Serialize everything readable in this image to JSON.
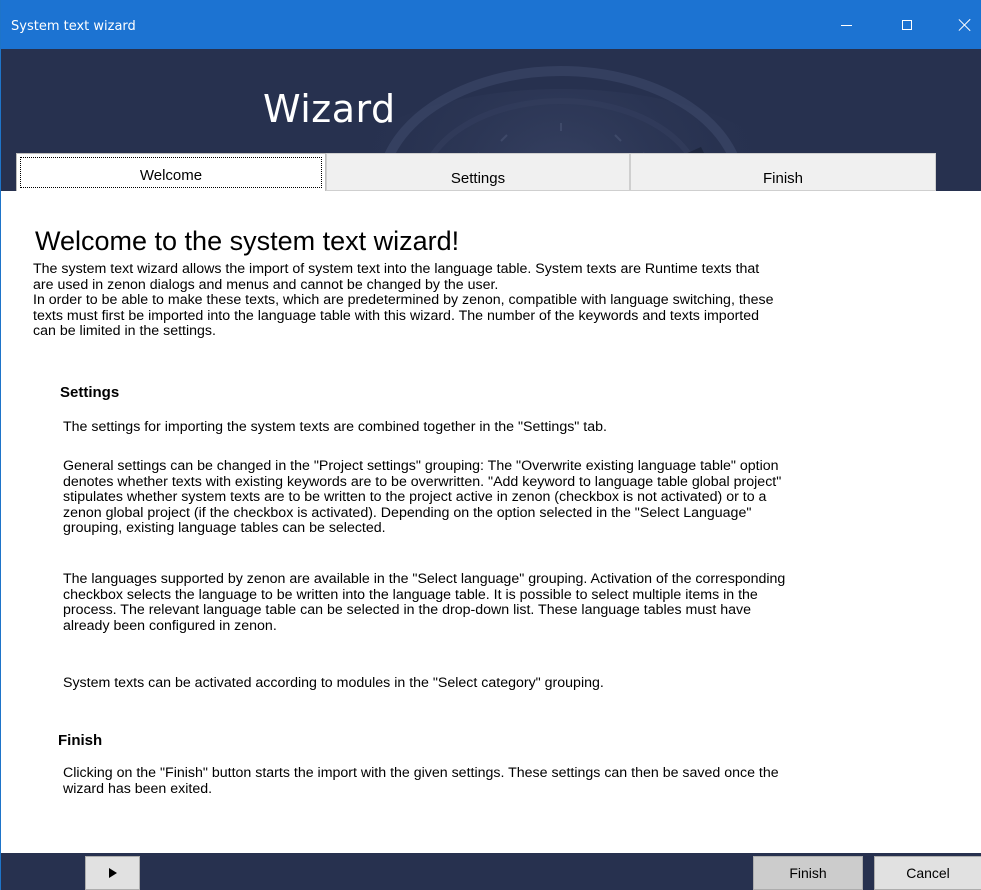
{
  "window": {
    "title": "System text wizard",
    "controls": {
      "minimize": "minimize-icon",
      "maximize": "maximize-icon",
      "close": "close-icon"
    }
  },
  "banner": {
    "title": "Wizard"
  },
  "tabs": [
    {
      "label": "Welcome",
      "active": true
    },
    {
      "label": "Settings",
      "active": false
    },
    {
      "label": "Finish",
      "active": false
    }
  ],
  "content": {
    "heading": "Welcome to the system text wizard!",
    "intro": [
      "The system text wizard allows the import of system text into the language table. System texts are Runtime texts  that",
      "are used in zenon dialogs and menus and cannot be changed by the user.",
      "In order to be able to make these texts, which are predetermined by zenon, compatible with language switching, these",
      "texts must first be imported into the language table with this wizard. The number of the keywords and texts imported",
      "can be limited in the settings."
    ],
    "settings": {
      "title": "Settings",
      "p1": [
        "The settings for importing the system texts are combined together in the \"Settings\" tab."
      ],
      "p2": [
        "General settings can be changed in the \"Project settings\" grouping: The \"Overwrite existing language table\" option",
        "denotes whether texts with existing keywords are to be overwritten. \"Add keyword to language table global project\"",
        "stipulates whether system texts are to be written to the project active in zenon (checkbox is not activated) or to a",
        "zenon global project (if the checkbox is activated). Depending on the option selected in the \"Select Language\"",
        "grouping, existing language tables can be selected."
      ],
      "p3": [
        "The languages supported by zenon are available in the \"Select language\" grouping. Activation of the corresponding",
        "checkbox selects the language to be written into the language table. It is possible to select multiple items in the",
        "process. The relevant language table can be selected in the drop-down list. These language tables must have",
        "already been configured in zenon."
      ],
      "p4": [
        "System texts can be activated according to modules in the \"Select category\" grouping."
      ]
    },
    "finish": {
      "title": "Finish",
      "p1": [
        "Clicking on the \"Finish\" button starts the import with the given settings. These settings can then be saved once the",
        "wizard has been exited."
      ]
    }
  },
  "footer": {
    "next_icon": "play-icon",
    "finish_label": "Finish",
    "cancel_label": "Cancel"
  },
  "colors": {
    "titlebar": "#1c73d2",
    "banner": "#27314f",
    "footer": "#27314f"
  }
}
